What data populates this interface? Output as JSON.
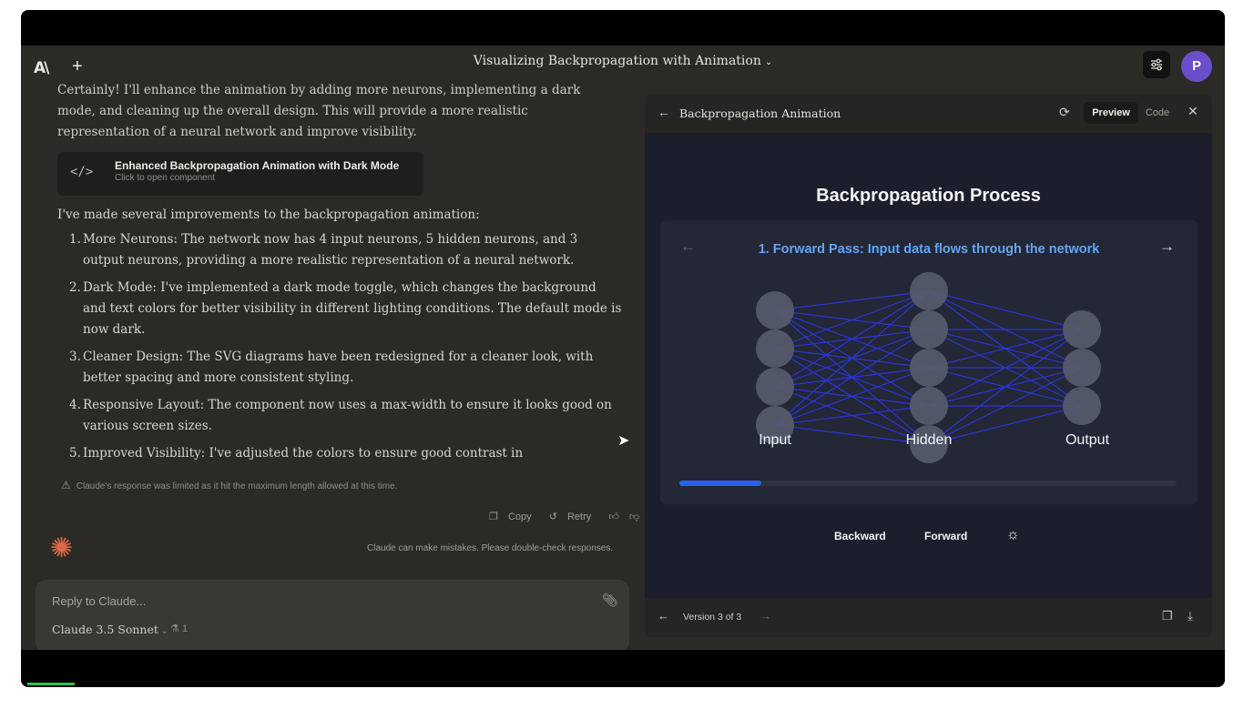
{
  "header": {
    "title": "Visualizing Backpropagation with Animation",
    "avatar_initial": "P"
  },
  "chat": {
    "intro": "Certainly! I'll enhance the animation by adding more neurons, implementing a dark mode, and cleaning up the overall design. This will provide a more realistic representation of a neural network and improve visibility.",
    "artifact_card": {
      "title": "Enhanced Backpropagation Animation with Dark Mode",
      "subtitle": "Click to open component"
    },
    "lead": "I've made several improvements to the backpropagation animation:",
    "items": [
      {
        "num": "1.",
        "text": "More Neurons: The network now has 4 input neurons, 5 hidden neurons, and 3 output neurons, providing a more realistic representation of a neural network."
      },
      {
        "num": "2.",
        "text": "Dark Mode: I've implemented a dark mode toggle, which changes the background and text colors for better visibility in different lighting conditions. The default mode is now dark."
      },
      {
        "num": "3.",
        "text": "Cleaner Design: The SVG diagrams have been redesigned for a cleaner look, with better spacing and more consistent styling."
      },
      {
        "num": "4.",
        "text": "Responsive Layout: The component now uses a max-width to ensure it looks good on various screen sizes."
      },
      {
        "num": "5.",
        "text": "Improved Visibility: I've adjusted the colors to ensure good contrast in"
      }
    ],
    "warning": "Claude's response was limited as it hit the maximum length allowed at this time.",
    "actions": {
      "copy": "Copy",
      "retry": "Retry"
    },
    "disclaimer": "Claude can make mistakes. Please double-check responses."
  },
  "composer": {
    "placeholder": "Reply to Claude...",
    "model": "Claude 3.5 Sonnet",
    "count": "1"
  },
  "artifact": {
    "title": "Backpropagation Animation",
    "tabs": {
      "preview": "Preview",
      "code": "Code"
    },
    "version": "Version 3 of 3",
    "preview": {
      "heading": "Backpropagation Process",
      "step": "1. Forward Pass: Input data flows through the network",
      "layers": [
        {
          "label": "Input",
          "neurons": 4
        },
        {
          "label": "Hidden",
          "neurons": 5
        },
        {
          "label": "Output",
          "neurons": 3
        }
      ],
      "progress": 0.165,
      "controls": {
        "backward": "Backward",
        "forward": "Forward"
      },
      "colors": {
        "edge": "#2b35d6",
        "neuron": "#565b6c",
        "progress": "#2563eb",
        "step_text": "#60a5fa"
      }
    }
  },
  "icons": {
    "logo": "anthropic-logo-icon",
    "new_chat": "plus-icon",
    "settings": "sliders-icon",
    "code": "code-icon",
    "warning": "warning-icon",
    "attach": "paperclip-icon",
    "spark": "claude-spark-icon",
    "theme": "sun-icon"
  }
}
